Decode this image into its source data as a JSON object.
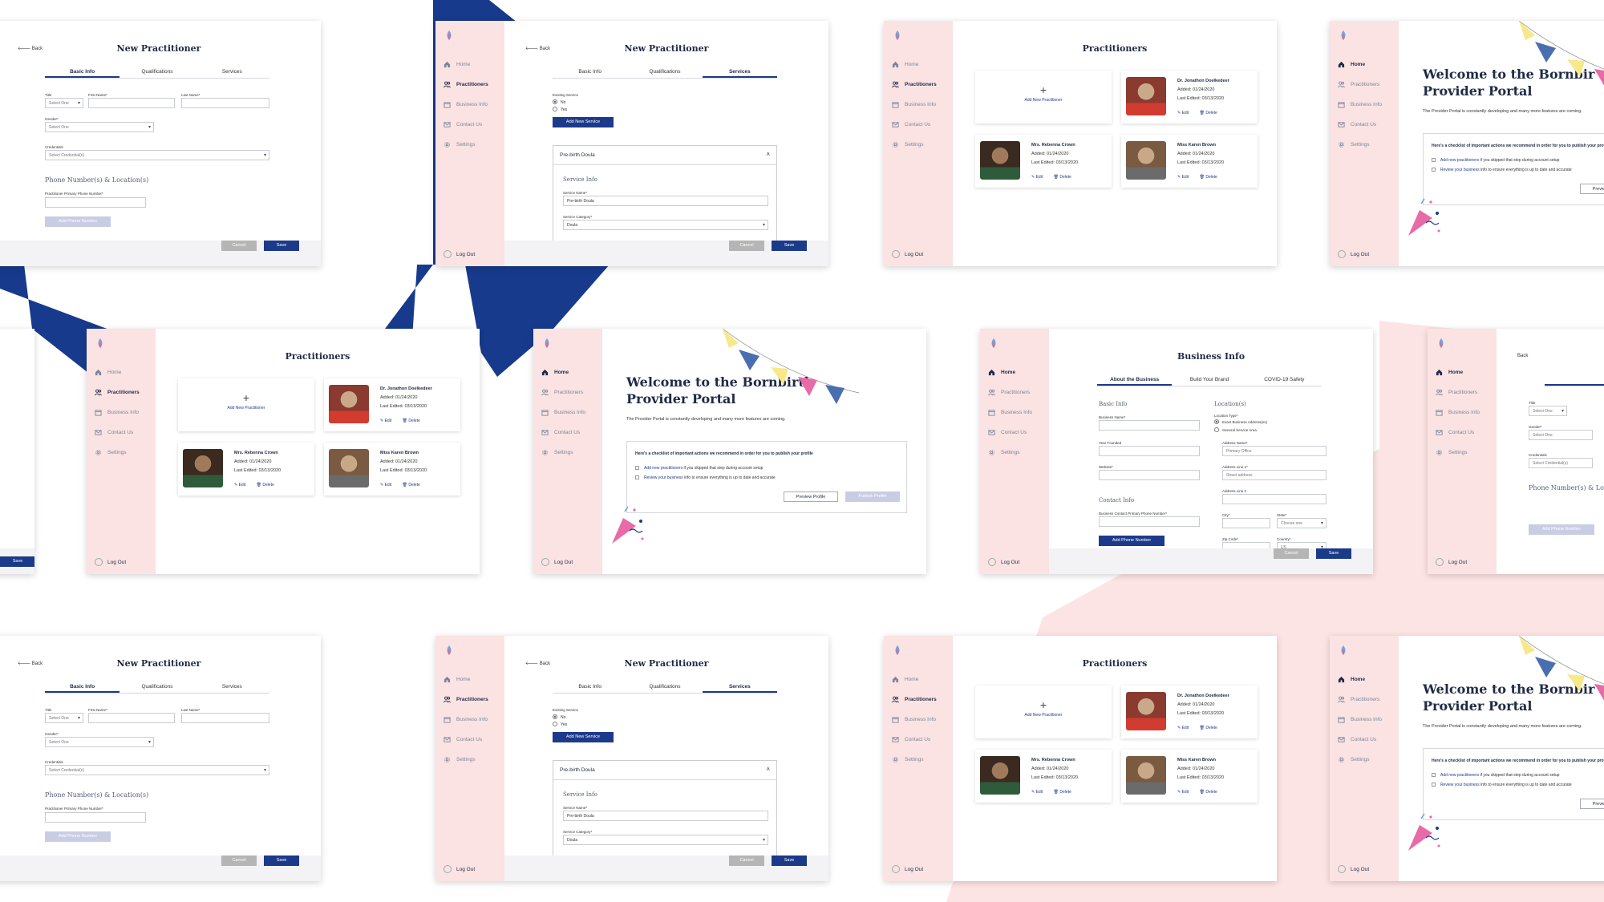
{
  "nav": {
    "home": "Home",
    "practitioners": "Practitioners",
    "business_info": "Business Info",
    "contact_us": "Contact Us",
    "settings": "Settings",
    "logout": "Log Out"
  },
  "common": {
    "back": "Back",
    "cancel": "Cancel",
    "save": "Save"
  },
  "colors": {
    "navy": "#1c3a8a",
    "pink": "#fbe3e3",
    "bg_pink": "#fde4e4"
  },
  "new_practitioner": {
    "title": "New Practitioner",
    "tabs": [
      "Basic Info",
      "Qualifications",
      "Services"
    ],
    "title_label": "Title",
    "title_value": "Select One",
    "first_name_label": "First Name*",
    "last_name_label": "Last Name*",
    "gender_label": "Gender*",
    "gender_value": "Select One",
    "credentials_label": "Credentials",
    "credentials_value": "Select Credential(s)",
    "phone_section": "Phone Number(s) & Location(s)",
    "phone_label": "Practitioner Primary Phone Number*",
    "add_phone": "Add Phone Number"
  },
  "services": {
    "existing_label": "Existing Service",
    "no": "No",
    "yes": "Yes",
    "add_new": "Add New Service",
    "accordion_title": "Pre-birth Doula",
    "section": "Service Info",
    "name_label": "Service Name*",
    "name_value": "Pre-birth Doula",
    "category_label": "Service Category*",
    "category_value": "Doula"
  },
  "practitioners": {
    "title": "Practitioners",
    "add_new": "Add New Practitioner",
    "edit": "Edit",
    "delete": "Delete",
    "list": [
      {
        "name": "Dr. Jonathon Doelkedeer",
        "added": "Added: 01/24/2020",
        "edited": "Last Edited: 03/13/2020"
      },
      {
        "name": "Mrs. Rebenna Crown",
        "added": "Added: 01/24/2020",
        "edited": "Last Edited: 03/13/2020"
      },
      {
        "name": "Miss Karen Brown",
        "added": "Added: 01/24/2020",
        "edited": "Last Edited: 03/13/2020"
      }
    ]
  },
  "welcome": {
    "title_line1": "Welcome to the Bornbir",
    "title_line2": "Provider Portal",
    "title_full_line1": "Welcome to the Bornbirth",
    "title_full_line2": "Provider Portal",
    "subtitle": "The Provider Portal is constantly developing and many more features are coming.",
    "checklist_head": "Here's a checklist of important actions we recommend in order for you to publish your profile",
    "item1_link": "Add new practitioners",
    "item1_rest": " if you skipped that step during account setup",
    "item2_link": "Review your business",
    "item2_rest": " info to ensure everything is up to date and accurate",
    "preview": "Preview Profile",
    "publish": "Publish Profile"
  },
  "business": {
    "title": "Business Info",
    "tabs": [
      "About the Business",
      "Build Your Brand",
      "COVID-19 Safety"
    ],
    "basic": "Basic Info",
    "name_label": "Business Name*",
    "year_label": "Year Founded",
    "website_label": "Website*",
    "contact": "Contact Info",
    "contact_phone_label": "Business Contact Primary Phone Number*",
    "add_phone": "Add Phone Number",
    "locations": "Location(s)",
    "loc_type": "Location Type*",
    "loc_exact": "Exact Business Address(es)",
    "loc_general": "General Service Area",
    "addr_name": "Address Name*",
    "addr_name_ph": "Primary Office",
    "addr1": "Address Line 1*",
    "addr1_ph": "Street address",
    "addr2": "Address Line 2",
    "city": "City*",
    "state": "State*",
    "state_ph": "Choose one",
    "zip": "Zip Code*",
    "country": "Country*",
    "country_val": "US"
  }
}
